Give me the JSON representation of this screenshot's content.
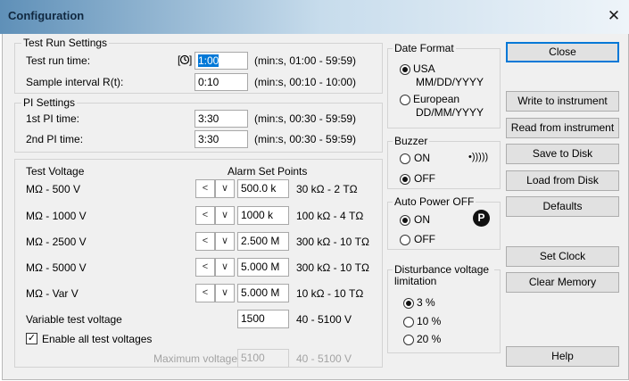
{
  "window": {
    "title": "Configuration",
    "close_glyph": "✕"
  },
  "test_run": {
    "legend": "Test Run Settings",
    "run_time_label": "Test run time:",
    "run_time_value": "1:00",
    "run_time_range": "(min:s, 01:00 - 59:59)",
    "interval_label": "Sample interval R(t):",
    "interval_value": "0:10",
    "interval_range": "(min:s, 00:10 - 10:00)",
    "timer_icon": "timer-icon"
  },
  "pi": {
    "legend": "PI Settings",
    "pi1_label": "1st PI time:",
    "pi1_value": "3:30",
    "pi1_range": "(min:s, 00:30 - 59:59)",
    "pi2_label": "2nd PI time:",
    "pi2_value": "3:30",
    "pi2_range": "(min:s, 00:30 - 59:59)"
  },
  "voltage": {
    "test_voltage_header": "Test Voltage",
    "alarm_header": "Alarm Set Points",
    "rows": [
      {
        "label": "MΩ - 500 V",
        "value": "500.0 k",
        "range": "30 kΩ - 2 TΩ"
      },
      {
        "label": "MΩ - 1000 V",
        "value": "1000 k",
        "range": "100 kΩ - 4 TΩ"
      },
      {
        "label": "MΩ - 2500 V",
        "value": "2.500 M",
        "range": "300 kΩ - 10 TΩ"
      },
      {
        "label": "MΩ - 5000 V",
        "value": "5.000 M",
        "range": "300 kΩ - 10 TΩ"
      },
      {
        "label": "MΩ - Var V",
        "value": "5.000 M",
        "range": "10 kΩ - 10 TΩ"
      }
    ],
    "variable_label": "Variable test voltage",
    "variable_value": "1500",
    "variable_range": "40 - 5100 V",
    "enable_all_label": "Enable all test voltages",
    "enable_all_checked": true,
    "max_label": "Maximum voltage:",
    "max_value": "5100",
    "max_range": "40 - 5100 V",
    "spin_left": "<",
    "spin_right": "∨"
  },
  "date_format": {
    "legend": "Date Format",
    "usa_label": "USA",
    "usa_format": "MM/DD/YYYY",
    "european_label": "European",
    "european_format": "DD/MM/YYYY",
    "selected": "usa"
  },
  "buzzer": {
    "legend": "Buzzer",
    "on_label": "ON",
    "off_label": "OFF",
    "selected": "off",
    "icon": "sound-icon",
    "icon_glyph": "•)))))"
  },
  "auto_power": {
    "legend": "Auto Power OFF",
    "on_label": "ON",
    "off_label": "OFF",
    "selected": "on",
    "badge": "P"
  },
  "disturbance": {
    "legend": "Disturbance voltage limitation",
    "options": [
      "3 %",
      "10 %",
      "20 %"
    ],
    "selected": 0
  },
  "buttons": {
    "close": "Close",
    "write": "Write to instrument",
    "read": "Read from instrument",
    "save": "Save to Disk",
    "load": "Load from Disk",
    "defaults": "Defaults",
    "set_clock": "Set Clock",
    "clear_memory": "Clear Memory",
    "help": "Help"
  },
  "colors": {
    "accent": "#0078d7",
    "title_gradient_start": "#5f90b8",
    "title_gradient_end": "#eef4f9",
    "dialog_bg": "#f0f0f0"
  }
}
